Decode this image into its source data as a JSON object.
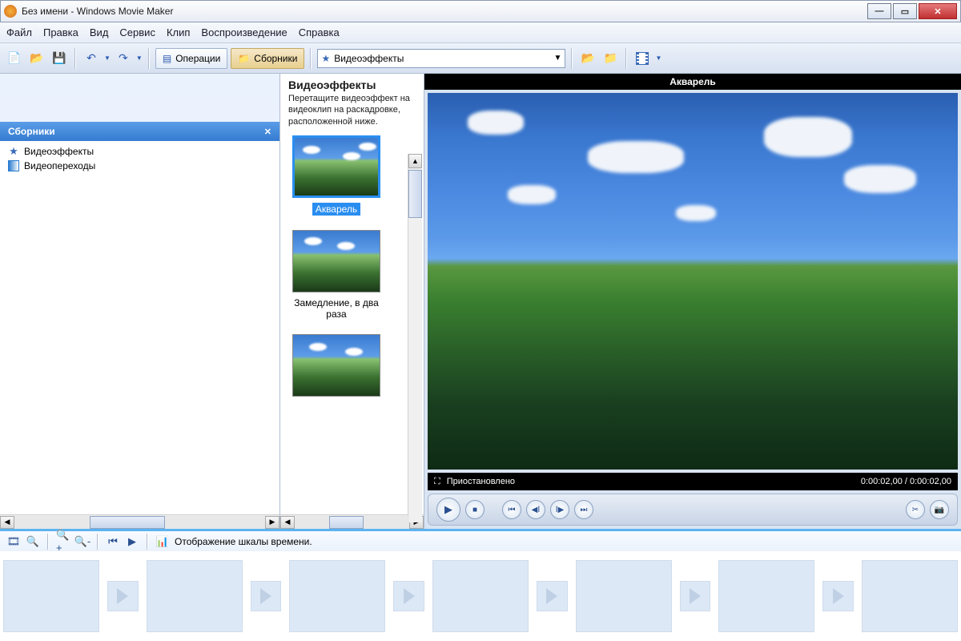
{
  "window": {
    "title": "Без имени - Windows Movie Maker"
  },
  "menu": {
    "file": "Файл",
    "edit": "Правка",
    "view": "Вид",
    "tools": "Сервис",
    "clip": "Клип",
    "play": "Воспроизведение",
    "help": "Справка"
  },
  "toolbar": {
    "operations": "Операции",
    "collections": "Сборники",
    "combo_selected": "Видеоэффекты"
  },
  "sidebar": {
    "header": "Сборники",
    "items": [
      {
        "label": "Видеоэффекты",
        "kind": "star"
      },
      {
        "label": "Видеопереходы",
        "kind": "trans"
      }
    ]
  },
  "effects": {
    "title": "Видеоэффекты",
    "instructions": "Перетащите видеоэффект на видеоклип на раскадровке, расположенной ниже.",
    "items": [
      {
        "label": "Акварель",
        "selected": true
      },
      {
        "label": "Замедление, в два раза",
        "selected": false
      },
      {
        "label": "",
        "selected": false
      }
    ]
  },
  "preview": {
    "clip_title": "Акварель",
    "status": "Приостановлено",
    "time_current": "0:00:02,00",
    "time_total": "0:00:02,00"
  },
  "timeline": {
    "label": "Отображение шкалы времени."
  }
}
